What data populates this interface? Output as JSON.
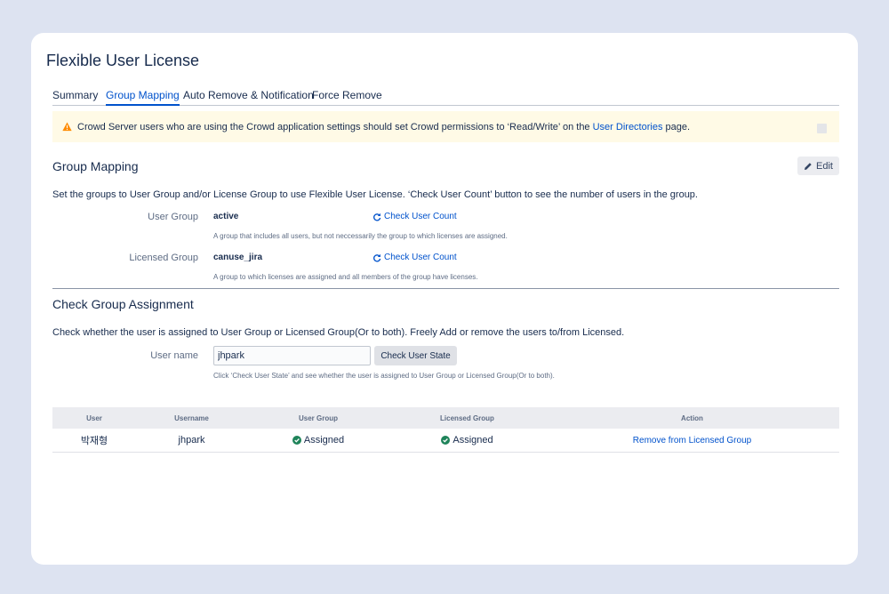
{
  "page": {
    "title": "Flexible User License"
  },
  "tabs": [
    {
      "label": "Summary",
      "active": false
    },
    {
      "label": "Group Mapping",
      "active": true
    },
    {
      "label": "Auto Remove & Notification",
      "active": false
    },
    {
      "label": "Force Remove",
      "active": false
    }
  ],
  "warning": {
    "icon": "warning-triangle-icon",
    "text_before": "Crowd Server users who are using the Crowd application settings should set Crowd permissions to ‘Read/Write’ on the ",
    "link": "User Directories",
    "text_after": " page."
  },
  "group_mapping": {
    "title": "Group Mapping",
    "edit_label": "Edit",
    "description": "Set the groups to User Group and/or License Group to use Flexible User License. ‘Check User Count’ button to see the number of users in the group.",
    "user_group": {
      "label": "User Group",
      "value": "active",
      "check_label": "Check User Count",
      "help": "A group that includes all users, but not neccessarily the group to which licenses are assigned."
    },
    "licensed_group": {
      "label": "Licensed Group",
      "value": "canuse_jira",
      "check_label": "Check User Count",
      "help": "A group to which licenses are assigned and all members of the group have licenses."
    }
  },
  "check_assignment": {
    "title": "Check Group Assignment",
    "description": "Check whether the user is assigned to User Group or Licensed Group(Or to both). Freely Add or remove the users to/from Licensed.",
    "username_label": "User name",
    "username_value": "jhpark",
    "button_label": "Check User State",
    "help": "Click ‘Check User State’ and see whether the user is assigned to User Group or Licensed Group(Or to both)."
  },
  "table": {
    "headers": {
      "user": "User",
      "username": "Username",
      "user_group": "User Group",
      "licensed_group": "Licensed Group",
      "action": "Action"
    },
    "rows": [
      {
        "user": "박재형",
        "username": "jhpark",
        "user_group": "Assigned",
        "licensed_group": "Assigned",
        "action": "Remove from Licensed Group"
      }
    ]
  },
  "colors": {
    "accent": "#0052cc",
    "warning_bg": "#fffae6",
    "warning_icon": "#ff8b00",
    "success": "#36b37e"
  }
}
